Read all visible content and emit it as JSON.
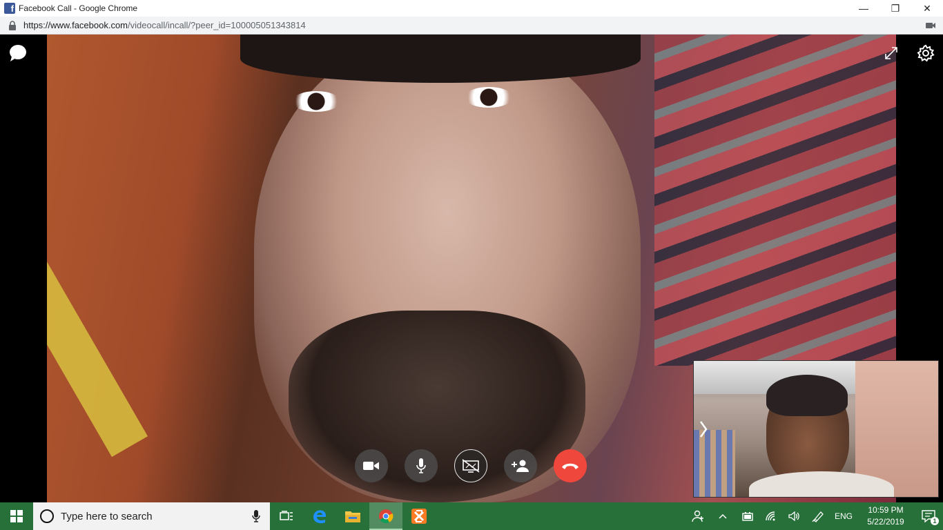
{
  "window": {
    "title": "Facebook Call - Google Chrome",
    "favicon_letter": "f",
    "controls": {
      "minimize": "—",
      "maximize": "❐",
      "close": "✕"
    }
  },
  "address": {
    "scheme_host": "https://www.facebook.com",
    "path": "/videocall/incall/?peer_id=100005051343814"
  },
  "call": {
    "controls": [
      "camera-toggle",
      "microphone-toggle",
      "screen-share",
      "add-person",
      "end-call"
    ],
    "colors": {
      "hangup": "#f0473c",
      "control_bg": "#505050"
    }
  },
  "taskbar": {
    "search_placeholder": "Type here to search",
    "apps": [
      "task-view",
      "edge",
      "file-explorer",
      "chrome",
      "xampp"
    ],
    "active_app": "chrome",
    "language": "ENG",
    "time": "10:59 PM",
    "date": "5/22/2019",
    "notification_count": "1",
    "color": "#28703a"
  }
}
